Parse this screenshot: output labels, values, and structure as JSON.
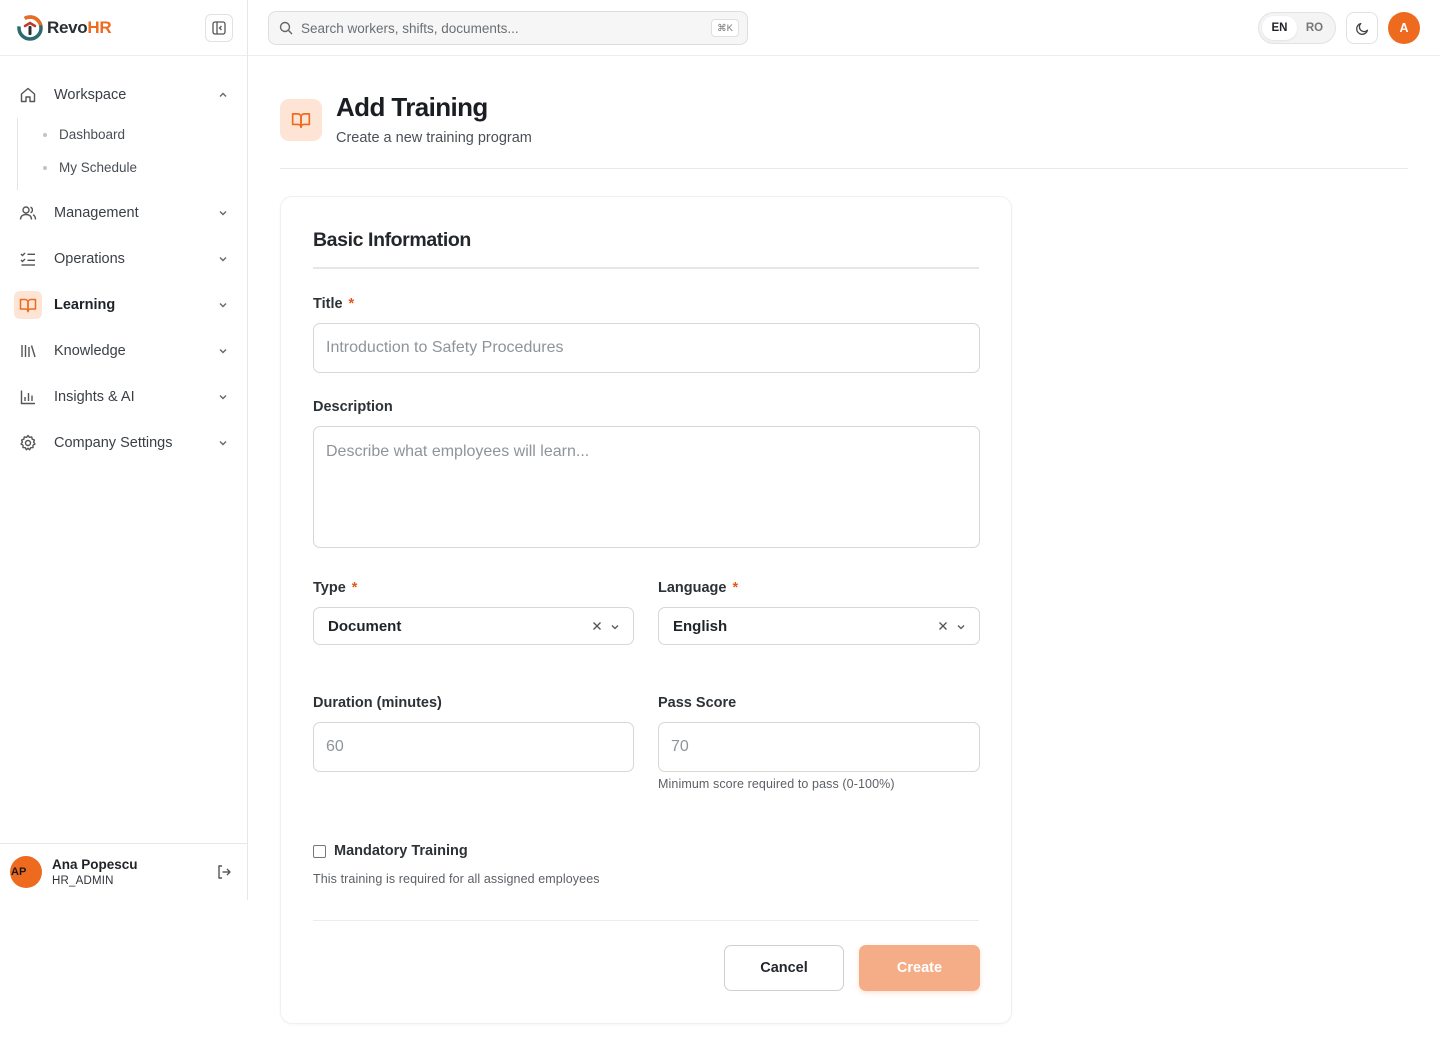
{
  "brand": {
    "part1": "Revo",
    "part2": "HR"
  },
  "sidebar": {
    "items": [
      {
        "label": "Workspace",
        "icon": "home-icon",
        "expanded": true
      },
      {
        "label": "Management",
        "icon": "users-icon"
      },
      {
        "label": "Operations",
        "icon": "checklist-icon"
      },
      {
        "label": "Learning",
        "icon": "book-open-icon",
        "active": true
      },
      {
        "label": "Knowledge",
        "icon": "library-icon"
      },
      {
        "label": "Insights & AI",
        "icon": "bar-chart-icon"
      },
      {
        "label": "Company Settings",
        "icon": "gear-icon"
      }
    ],
    "workspace_sub": [
      {
        "label": "Dashboard"
      },
      {
        "label": "My Schedule"
      }
    ]
  },
  "user": {
    "initials": "AP",
    "name": "Ana Popescu",
    "role": "HR_ADMIN"
  },
  "topbar": {
    "search_placeholder": "Search workers, shifts, documents...",
    "search_shortcut": "⌘K",
    "lang_en": "EN",
    "lang_ro": "RO",
    "active_lang": "EN",
    "avatar_initial": "A"
  },
  "page": {
    "title": "Add Training",
    "subtitle": "Create a new training program"
  },
  "form": {
    "section_title": "Basic Information",
    "title_label": "Title",
    "title_placeholder": "Introduction to Safety Procedures",
    "description_label": "Description",
    "description_placeholder": "Describe what employees will learn...",
    "type_label": "Type",
    "type_value": "Document",
    "language_label": "Language",
    "language_value": "English",
    "duration_label": "Duration (minutes)",
    "duration_placeholder": "60",
    "pass_score_label": "Pass Score",
    "pass_score_placeholder": "70",
    "pass_score_help": "Minimum score required to pass (0-100%)",
    "mandatory_label": "Mandatory Training",
    "mandatory_help": "This training is required for all assigned employees",
    "mandatory_checked": false,
    "required_marker": "*",
    "cancel_label": "Cancel",
    "create_label": "Create"
  },
  "colors": {
    "accent": "#ee6a1f",
    "accent_soft": "#fde4d4",
    "create_disabled": "#f5ad88"
  }
}
